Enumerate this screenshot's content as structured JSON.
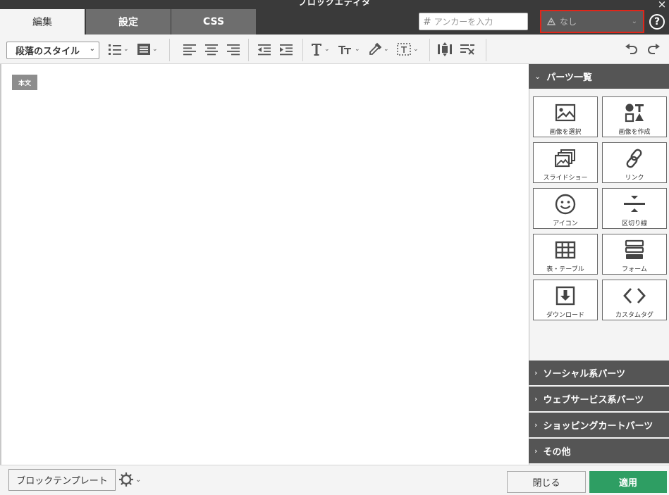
{
  "window": {
    "title": "ブロックエディタ",
    "close_icon": "×"
  },
  "tabs": [
    {
      "label": "編集",
      "active": true
    },
    {
      "label": "設定",
      "active": false
    },
    {
      "label": "CSS",
      "active": false
    }
  ],
  "anchor": {
    "hash": "#",
    "placeholder": "アンカーを入力",
    "value": ""
  },
  "condition_select": {
    "value": "なし",
    "icon": "triangle-icon",
    "highlight_color": "#e0261a"
  },
  "help": {
    "label": "?"
  },
  "toolbar": {
    "paragraph_style": "段落のスタイル",
    "tools": [
      "bullet-list-icon",
      "block-format-icon",
      "align-left-icon",
      "align-center-icon",
      "align-right-icon",
      "outdent-icon",
      "indent-icon",
      "text-size-icon",
      "font-size-icon",
      "color-picker-icon",
      "border-icon",
      "insert-block-icon",
      "clear-format-icon",
      "undo-icon",
      "redo-icon"
    ]
  },
  "canvas": {
    "block_badge": "本文"
  },
  "parts_panel": {
    "title": "パーツ一覧",
    "items": [
      {
        "label": "画像を選択",
        "icon": "image-icon"
      },
      {
        "label": "画像を作成",
        "icon": "shapes-icon"
      },
      {
        "label": "スライドショー",
        "icon": "slideshow-icon"
      },
      {
        "label": "リンク",
        "icon": "link-icon"
      },
      {
        "label": "アイコン",
        "icon": "smiley-icon"
      },
      {
        "label": "区切り線",
        "icon": "divider-icon"
      },
      {
        "label": "表・テーブル",
        "icon": "table-icon"
      },
      {
        "label": "フォーム",
        "icon": "form-icon"
      },
      {
        "label": "ダウンロード",
        "icon": "download-icon"
      },
      {
        "label": "カスタムタグ",
        "icon": "code-icon"
      }
    ],
    "sections": [
      {
        "label": "ソーシャル系パーツ"
      },
      {
        "label": "ウェブサービス系パーツ"
      },
      {
        "label": "ショッピングカートパーツ"
      },
      {
        "label": "その他"
      }
    ]
  },
  "footer": {
    "template_button": "ブロックテンプレート",
    "close_button": "閉じる",
    "apply_button": "適用",
    "apply_color": "#2e9e63"
  }
}
